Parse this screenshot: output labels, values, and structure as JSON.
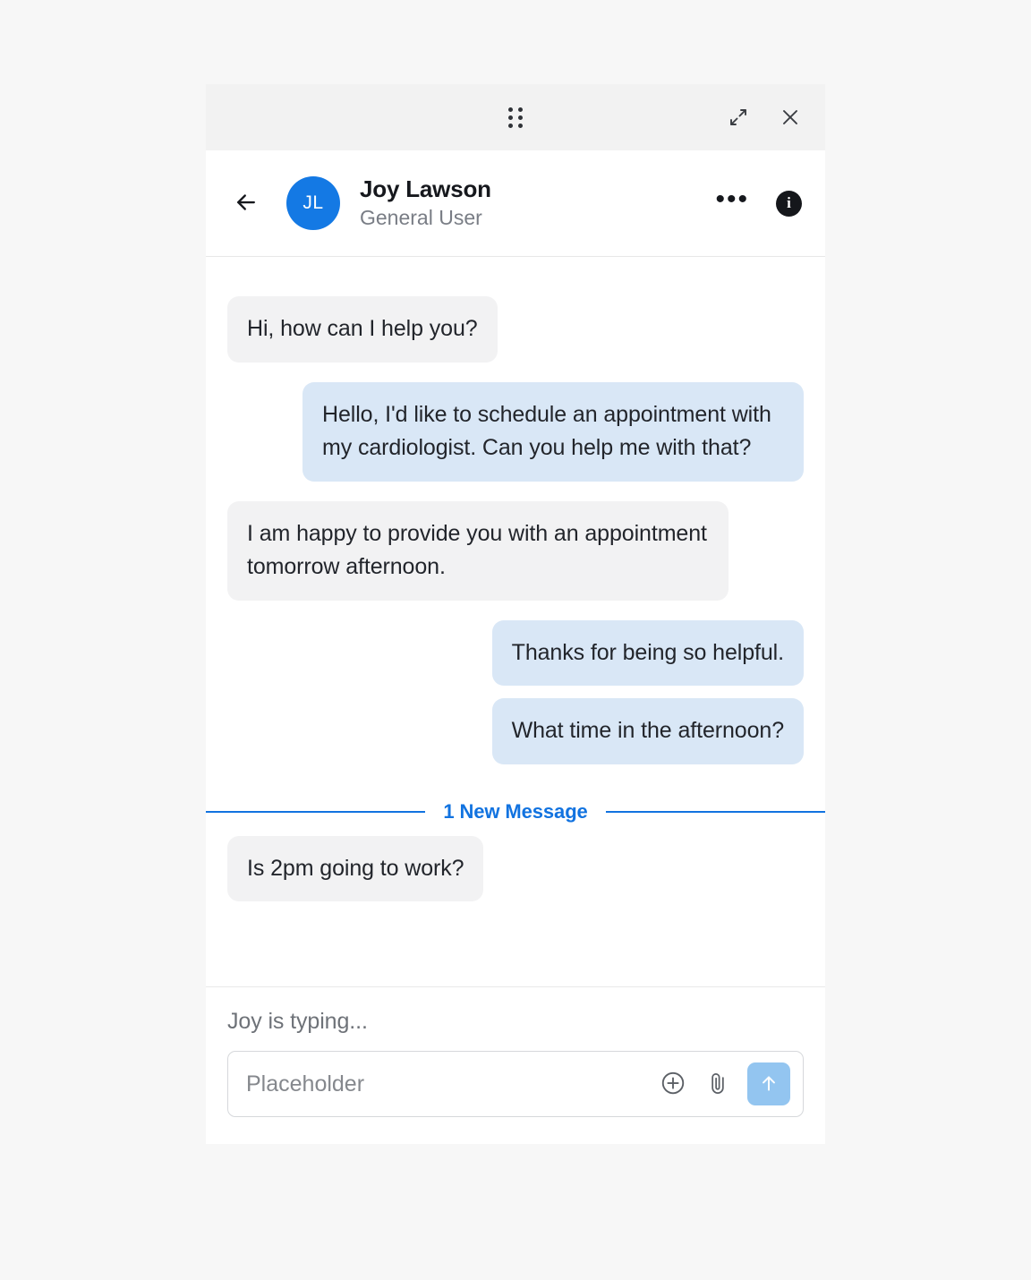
{
  "window": {
    "title_bar": {
      "drag_handle": "drag-handle-icon",
      "expand_label": "expand-icon",
      "close_label": "close-icon"
    }
  },
  "header": {
    "back_icon": "back-arrow-icon",
    "avatar_initials": "JL",
    "name": "Joy Lawson",
    "role": "General User",
    "more_label": "•••",
    "info_label": "i",
    "avatar_color": "#1479e4"
  },
  "conversation": {
    "messages": [
      {
        "direction": "incoming",
        "text": "Hi, how can I help you?"
      },
      {
        "direction": "outgoing",
        "text": "Hello, I'd like to schedule an appointment with my cardiologist. Can you help me with that?"
      },
      {
        "direction": "incoming",
        "text": "I am happy to provide you with an appointment tomorrow afternoon."
      },
      {
        "direction": "outgoing",
        "text": "Thanks for being so helpful."
      },
      {
        "direction": "outgoing",
        "text": "What time in the afternoon?"
      }
    ],
    "divider": {
      "label": "1 New Message",
      "color": "#1273e0"
    },
    "new_messages": [
      {
        "direction": "incoming",
        "text": "Is 2pm going to work?"
      }
    ]
  },
  "composer": {
    "typing_status": "Joy is typing...",
    "input_value": "",
    "input_placeholder": "Placeholder",
    "add_icon": "plus-circle-icon",
    "attach_icon": "paperclip-icon",
    "send_icon": "send-arrow-up-icon",
    "send_color": "#93c5f0"
  }
}
